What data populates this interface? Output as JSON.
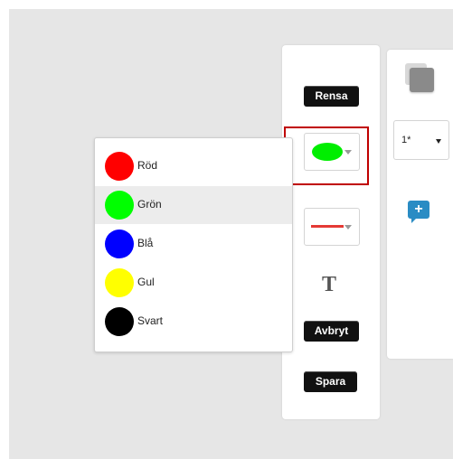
{
  "toolbar": {
    "clear_label": "Rensa",
    "cancel_label": "Avbryt",
    "save_label": "Spara",
    "text_tool_glyph": "T",
    "selected_fill_color": "#00ee00",
    "selected_line_color": "#e53935"
  },
  "right_panel": {
    "line_width_value": "1*",
    "layer_icon": "layer-square-icon",
    "add_comment_icon": "add-comment-icon",
    "add_comment_color": "#2a8cc4"
  },
  "color_menu": {
    "items": [
      {
        "label": "Röd",
        "color": "#ff0000"
      },
      {
        "label": "Grön",
        "color": "#00ff00",
        "selected": true
      },
      {
        "label": "Blå",
        "color": "#0000ff"
      },
      {
        "label": "Gul",
        "color": "#ffff00"
      },
      {
        "label": "Svart",
        "color": "#000000"
      }
    ]
  }
}
